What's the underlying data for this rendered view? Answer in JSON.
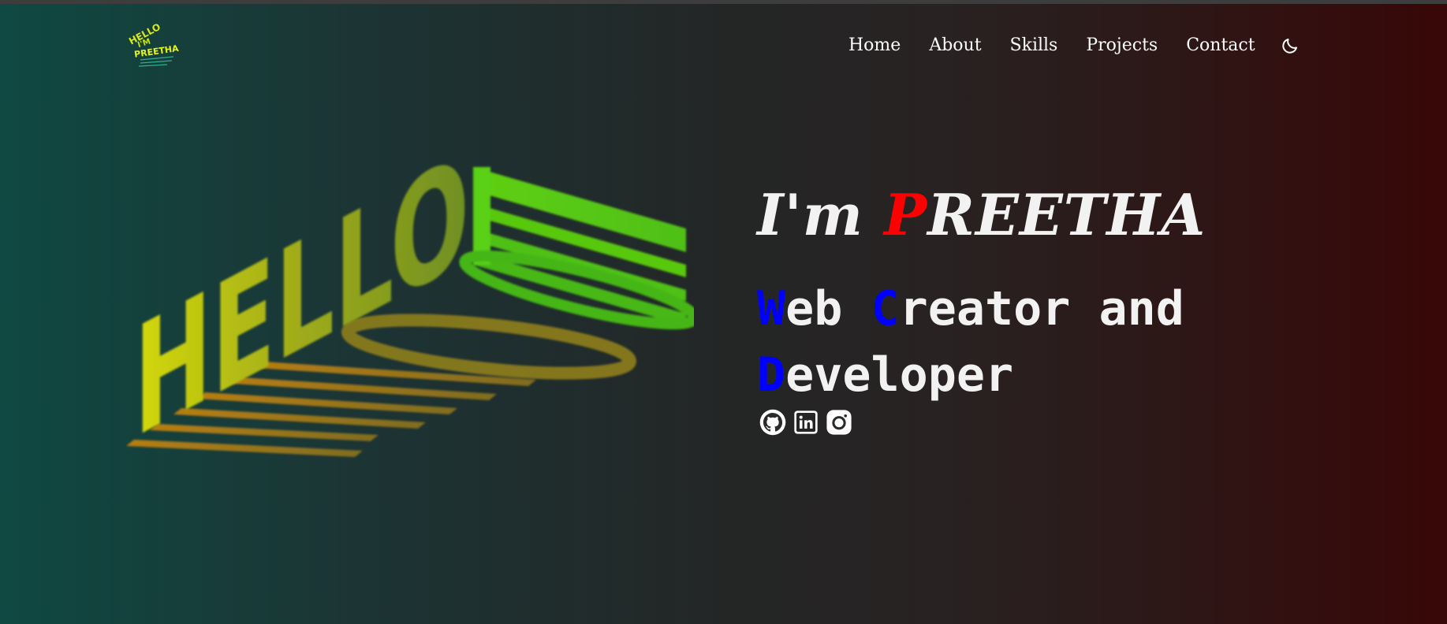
{
  "colors": {
    "accent_red": "#ff0000",
    "accent_blue": "#0000ff",
    "text": "#f2f2f2",
    "bg_left": "#0f4942",
    "bg_right": "#380707"
  },
  "logo": {
    "icon": "hello-im-preetha-logo",
    "text_lines": [
      "HELLO",
      "I'M",
      "PREETHA"
    ]
  },
  "nav": {
    "items": [
      {
        "label": "Home"
      },
      {
        "label": "About"
      },
      {
        "label": "Skills"
      },
      {
        "label": "Projects"
      },
      {
        "label": "Contact"
      }
    ],
    "theme_toggle_icon": "moon-icon"
  },
  "hero_art": {
    "icon": "hello-3d-text-art",
    "text": "HELLO"
  },
  "hero": {
    "name_prefix": "I'm ",
    "name_initial": "P",
    "name_rest": "REETHA",
    "role": {
      "w_initial": "W",
      "w_rest": "eb ",
      "c_initial": "C",
      "c_rest": "reator and",
      "d_initial": "D",
      "d_rest": "eveloper"
    }
  },
  "socials": [
    {
      "icon": "github-icon"
    },
    {
      "icon": "linkedin-icon"
    },
    {
      "icon": "instagram-icon"
    }
  ]
}
